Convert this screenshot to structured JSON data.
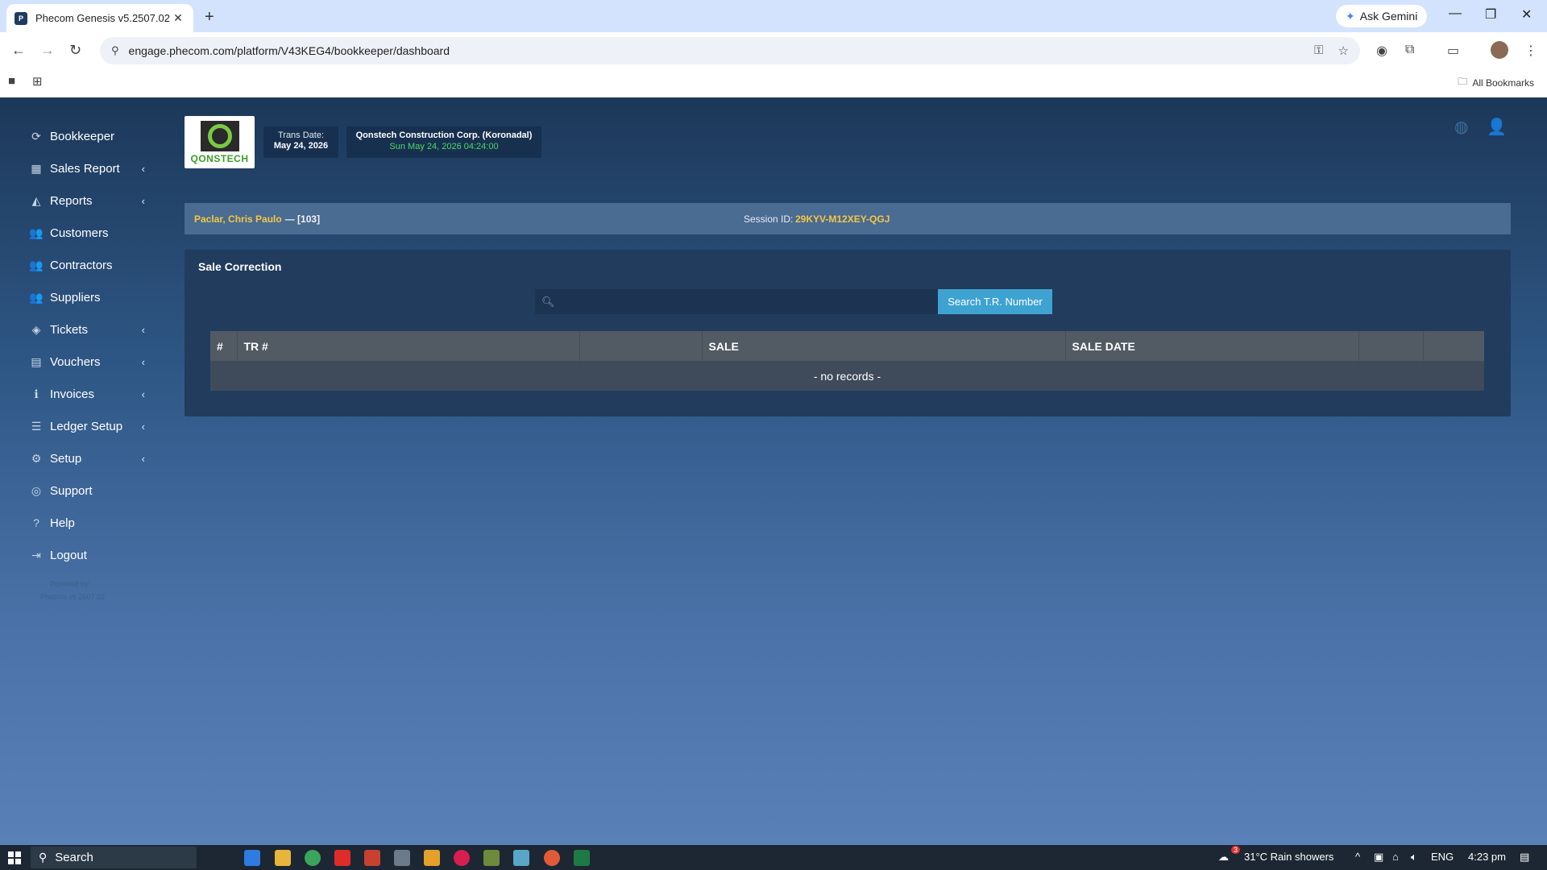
{
  "browser": {
    "tab_title": "Phecom Genesis v5.2507.02",
    "url": "engage.phecom.com/platform/V43KEG4/bookkeeper/dashboard",
    "ask_gemini": "Ask Gemini",
    "all_bookmarks": "All Bookmarks"
  },
  "sidebar": {
    "items": [
      {
        "label": "Bookkeeper",
        "icon": "refresh-icon",
        "glyph": "⟳",
        "has_sub": false
      },
      {
        "label": "Sales Report",
        "icon": "grid-icon",
        "glyph": "▦",
        "has_sub": true
      },
      {
        "label": "Reports",
        "icon": "area-chart-icon",
        "glyph": "◭",
        "has_sub": true
      },
      {
        "label": "Customers",
        "icon": "users-icon",
        "glyph": "👥",
        "has_sub": false
      },
      {
        "label": "Contractors",
        "icon": "users-icon",
        "glyph": "👥",
        "has_sub": false
      },
      {
        "label": "Suppliers",
        "icon": "users-icon",
        "glyph": "👥",
        "has_sub": false
      },
      {
        "label": "Tickets",
        "icon": "tag-icon",
        "glyph": "◈",
        "has_sub": true
      },
      {
        "label": "Vouchers",
        "icon": "file-icon",
        "glyph": "▤",
        "has_sub": true
      },
      {
        "label": "Invoices",
        "icon": "info-icon",
        "glyph": "ℹ",
        "has_sub": true
      },
      {
        "label": "Ledger Setup",
        "icon": "list-icon",
        "glyph": "☰",
        "has_sub": true
      },
      {
        "label": "Setup",
        "icon": "cogs-icon",
        "glyph": "⚙",
        "has_sub": true
      },
      {
        "label": "Support",
        "icon": "lifering-icon",
        "glyph": "◎",
        "has_sub": false
      },
      {
        "label": "Help",
        "icon": "question-icon",
        "glyph": "?",
        "has_sub": false
      },
      {
        "label": "Logout",
        "icon": "sign-out-icon",
        "glyph": "⇥",
        "has_sub": false
      }
    ],
    "powered_by": "Powered by:",
    "version": "Phecom v5.2507.02"
  },
  "header": {
    "logo_text": "QONSTECH",
    "trans_date_label": "Trans Date:",
    "trans_date": "May 24, 2026",
    "company": "Qonstech Construction Corp. (Koronadal)",
    "datetime": "Sun May 24, 2026 04:24:00"
  },
  "user_bar": {
    "name": "Paclar, Chris Paulo",
    "id": "— [103]",
    "session_label": "Session ID:",
    "session_id": "29KYV-M12XEY-QGJ"
  },
  "panel": {
    "title": "Sale Correction",
    "search_placeholder": "",
    "search_button": "Search T.R. Number",
    "columns": [
      "#",
      "TR #",
      "",
      "SALE",
      "SALE DATE",
      "",
      ""
    ],
    "empty_text": "- no records -"
  },
  "taskbar": {
    "search": "Search",
    "weather": "31°C  Rain showers",
    "lang": "ENG",
    "time": "4:23 pm",
    "weather_badge": "3"
  }
}
